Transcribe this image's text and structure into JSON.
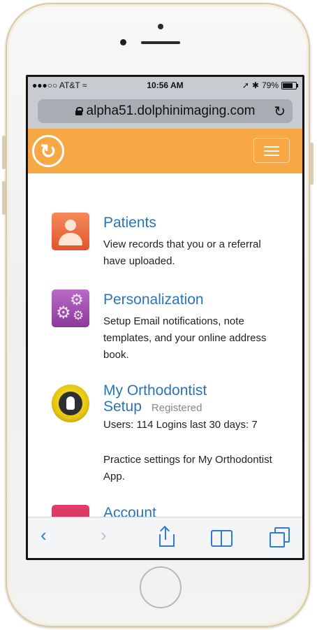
{
  "status": {
    "carrier": "●●●○○ AT&T",
    "time": "10:56 AM",
    "battery": "79%",
    "battery_level": 0.79
  },
  "browser": {
    "url": "alpha51.dolphinimaging.com"
  },
  "menu": [
    {
      "title": "Patients",
      "description": "View records that you or a referral have uploaded."
    },
    {
      "title": "Personalization",
      "description": "Setup Email notifications, note templates, and your online address book."
    },
    {
      "title_line1": "My Orthodontist",
      "title_line2": "Setup",
      "badge": "Registered",
      "stats": "Users: 114  Logins last 30 days: 7",
      "description": "Practice settings for My Orthodontist App."
    },
    {
      "title": "Account"
    }
  ],
  "colors": {
    "header": "#f7a844",
    "link": "#2b74b6",
    "toolbar_icon": "#2f7ad8"
  },
  "icons": {
    "patients": "person-icon",
    "personalization": "gears-icon",
    "orthodontist": "tooth-icon",
    "account": "briefcase-icon"
  }
}
